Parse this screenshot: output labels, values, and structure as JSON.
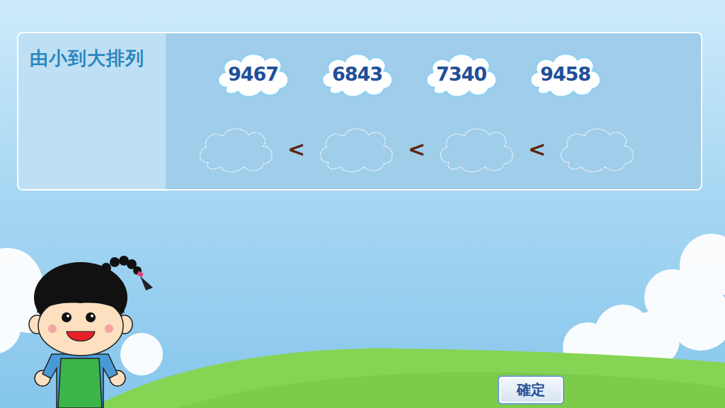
{
  "instruction": "由小到大排列",
  "numbers": [
    {
      "value": "9467"
    },
    {
      "value": "6843"
    },
    {
      "value": "7340"
    },
    {
      "value": "9458"
    }
  ],
  "slots": [
    {
      "filled": false
    },
    {
      "filled": false
    },
    {
      "filled": false
    },
    {
      "filled": false
    }
  ],
  "separators": [
    "<",
    "<",
    "<"
  ],
  "buttons": [
    "確定"
  ]
}
